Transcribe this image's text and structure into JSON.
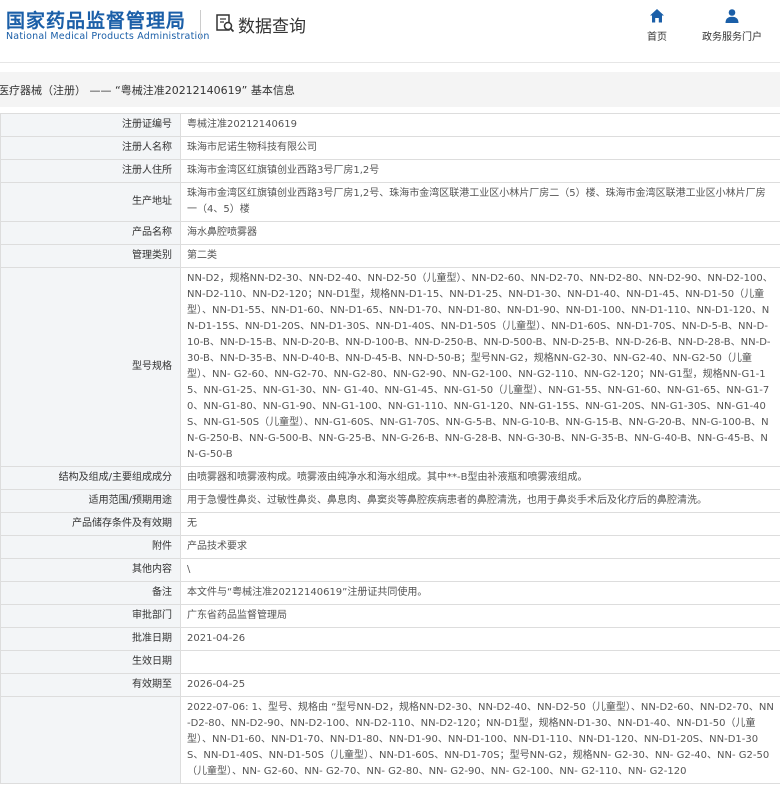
{
  "header": {
    "logo_cn": "国家药品监督管理局",
    "logo_en": "National Medical Products Administration",
    "query_title": "数据查询",
    "nav": [
      {
        "label": "首页",
        "icon": "home-icon"
      },
      {
        "label": "政务服务门户",
        "icon": "user-icon"
      }
    ]
  },
  "breadcrumb": "医疗器械（注册） —— “粤械注准20212140619” 基本信息",
  "rows": [
    {
      "label": "注册证编号",
      "value": "粤械注准20212140619"
    },
    {
      "label": "注册人名称",
      "value": "珠海市尼诺生物科技有限公司"
    },
    {
      "label": "注册人住所",
      "value": "珠海市金湾区红旗镇创业西路3号厂房1,2号"
    },
    {
      "label": "生产地址",
      "value": "珠海市金湾区红旗镇创业西路3号厂房1,2号、珠海市金湾区联港工业区小林片厂房二（5）楼、珠海市金湾区联港工业区小林片厂房一（4、5）楼"
    },
    {
      "label": "产品名称",
      "value": "海水鼻腔喷雾器"
    },
    {
      "label": "管理类别",
      "value": "第二类"
    },
    {
      "label": "型号规格",
      "value": "NN-D2，规格NN-D2-30、NN-D2-40、NN-D2-50（儿童型）、NN-D2-60、NN-D2-70、NN-D2-80、NN-D2-90、NN-D2-100、NN-D2-110、NN-D2-120；NN-D1型，规格NN-D1-15、NN-D1-25、NN-D1-30、NN-D1-40、NN-D1-45、NN-D1-50（儿童型）、NN-D1-55、NN-D1-60、NN-D1-65、NN-D1-70、NN-D1-80、NN-D1-90、NN-D1-100、NN-D1-110、NN-D1-120、NN-D1-15S、NN-D1-20S、NN-D1-30S、NN-D1-40S、NN-D1-50S（儿童型）、NN-D1-60S、NN-D1-70S、NN-D-5-B、NN-D-10-B、NN-D-15-B、NN-D-20-B、NN-D-100-B、NN-D-250-B、NN-D-500-B、NN-D-25-B、NN-D-26-B、NN-D-28-B、NN-D-30-B、NN-D-35-B、NN-D-40-B、NN-D-45-B、NN-D-50-B；型号NN-G2，规格NN-G2-30、NN-G2-40、NN-G2-50（儿童型）、NN- G2-60、NN-G2-70、NN-G2-80、NN-G2-90、NN-G2-100、NN-G2-110、NN-G2-120；NN-G1型，规格NN-G1-15、NN-G1-25、NN-G1-30、NN- G1-40、NN-G1-45、NN-G1-50（儿童型）、NN-G1-55、NN-G1-60、NN-G1-65、NN-G1-70、NN-G1-80、NN-G1-90、NN-G1-100、NN-G1-110、NN-G1-120、NN-G1-15S、NN-G1-20S、NN-G1-30S、NN-G1-40S、NN-G1-50S（儿童型）、NN-G1-60S、NN-G1-70S、NN-G-5-B、NN-G-10-B、NN-G-15-B、NN-G-20-B、NN-G-100-B、NN-G-250-B、NN-G-500-B、NN-G-25-B、NN-G-26-B、NN-G-28-B、NN-G-30-B、NN-G-35-B、NN-G-40-B、NN-G-45-B、NN-G-50-B"
    },
    {
      "label": "结构及组成/主要组成成分",
      "value": "由喷雾器和喷雾液构成。喷雾液由纯净水和海水组成。其中**-B型由补液瓶和喷雾液组成。"
    },
    {
      "label": "适用范围/预期用途",
      "value": "用于急慢性鼻炎、过敏性鼻炎、鼻息肉、鼻窦炎等鼻腔疾病患者的鼻腔清洗，也用于鼻炎手术后及化疗后的鼻腔清洗。"
    },
    {
      "label": "产品储存条件及有效期",
      "value": "无"
    },
    {
      "label": "附件",
      "value": "产品技术要求"
    },
    {
      "label": "其他内容",
      "value": "\\"
    },
    {
      "label": "备注",
      "value": "本文件与“粤械注准20212140619”注册证共同使用。"
    },
    {
      "label": "审批部门",
      "value": "广东省药品监督管理局"
    },
    {
      "label": "批准日期",
      "value": "2021-04-26"
    },
    {
      "label": "生效日期",
      "value": ""
    },
    {
      "label": "有效期至",
      "value": "2026-04-25"
    },
    {
      "label": "",
      "value": "2022-07-06: 1、型号、规格由 “型号NN-D2，规格NN-D2-30、NN-D2-40、NN-D2-50（儿童型）、NN-D2-60、NN-D2-70、NN-D2-80、NN-D2-90、NN-D2-100、NN-D2-110、NN-D2-120；NN-D1型，规格NN-D1-30、NN-D1-40、NN-D1-50（儿童型）、NN-D1-60、NN-D1-70、NN-D1-80、NN-D1-90、NN-D1-100、NN-D1-110、NN-D1-120、NN-D1-20S、NN-D1-30S、NN-D1-40S、NN-D1-50S（儿童型）、NN-D1-60S、NN-D1-70S；型号NN-G2，规格NN- G2-30、NN- G2-40、NN- G2-50（儿童型）、NN- G2-60、NN- G2-70、NN- G2-80、NN- G2-90、NN- G2-100、NN- G2-110、NN- G2-120"
    }
  ]
}
